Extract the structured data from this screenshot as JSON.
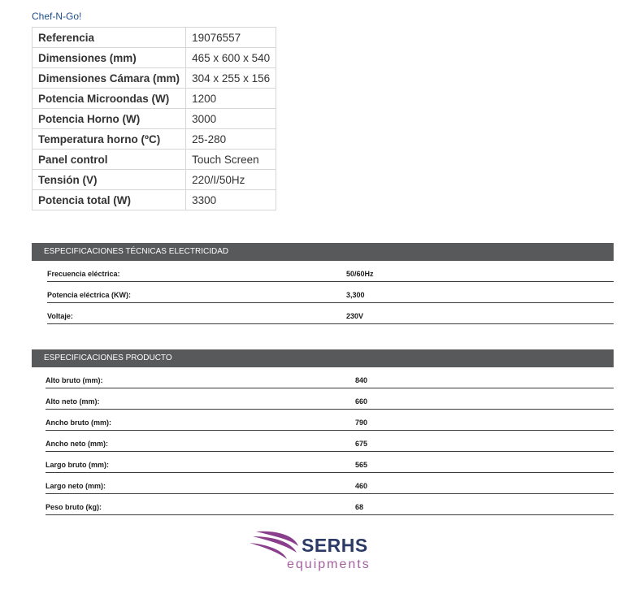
{
  "brand": "Chef-N-Go!",
  "specs": [
    {
      "label": "Referencia",
      "value": "19076557"
    },
    {
      "label": "Dimensiones (mm)",
      "value": "465 x 600 x 540"
    },
    {
      "label": "Dimensiones Cámara (mm)",
      "value": "304 x 255 x 156"
    },
    {
      "label": "Potencia Microondas (W)",
      "value": "1200"
    },
    {
      "label": "Potencia Horno (W)",
      "value": "3000"
    },
    {
      "label": "Temperatura horno (ºC)",
      "value": "25-280"
    },
    {
      "label": "Panel control",
      "value": "Touch Screen"
    },
    {
      "label": "Tensión (V)",
      "value": "220/I/50Hz"
    },
    {
      "label": "Potencia total (W)",
      "value": "3300"
    }
  ],
  "electricity": {
    "title": "ESPECIFICACIONES TÉCNICAS ELECTRICIDAD",
    "rows": [
      {
        "label": "Frecuencia eléctrica:",
        "value": "50/60Hz"
      },
      {
        "label": "Potencia eléctrica (KW):",
        "value": "3,300"
      },
      {
        "label": "Voltaje:",
        "value": "230V"
      }
    ]
  },
  "product": {
    "title": "ESPECIFICACIONES PRODUCTO",
    "rows": [
      {
        "label": "Alto bruto (mm):",
        "value": "840"
      },
      {
        "label": "Alto neto (mm):",
        "value": "660"
      },
      {
        "label": "Ancho bruto (mm):",
        "value": "790"
      },
      {
        "label": "Ancho neto (mm):",
        "value": "675"
      },
      {
        "label": "Largo bruto (mm):",
        "value": "565"
      },
      {
        "label": "Largo neto (mm):",
        "value": "460"
      },
      {
        "label": "Peso bruto (kg):",
        "value": "68"
      }
    ]
  },
  "logo": {
    "name": "SERHS",
    "sub": "equipments",
    "swoosh_color": "#8a3f8c"
  }
}
